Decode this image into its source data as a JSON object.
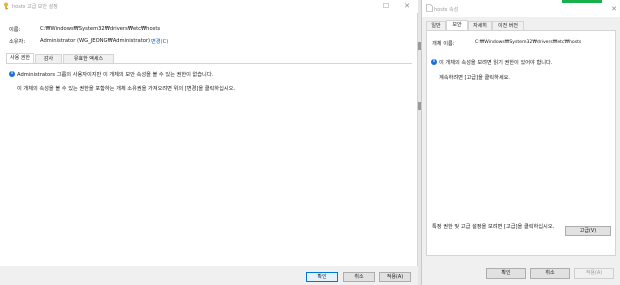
{
  "left_window": {
    "title": "hosts 고급 보안 설정",
    "name_label": "이름:",
    "name_value": "C:₩Windows₩System32₩drivers₩etc₩hosts",
    "owner_label": "소유자:",
    "owner_value": "Administrator (WG_JEONG₩Administrator)",
    "owner_change_link": "변경(C)",
    "tabs": [
      {
        "label": "사용 권한",
        "active": true
      },
      {
        "label": "감사",
        "active": false
      },
      {
        "label": "유효한 액세스",
        "active": false
      }
    ],
    "info_message": "Administrators 그룹의 사용자이지만 이 개체의 보안 속성을 볼 수 있는 권한이 없습니다.",
    "secondary_message": "이 개체의 속성을 볼 수 있는 권한을 포함하는 개체 소유권을 가져오려면 위의 [변경]을 클릭하십시오.",
    "buttons": {
      "ok": "확인",
      "cancel": "취소",
      "apply": "적용(A)"
    }
  },
  "right_window": {
    "title": "hosts 속성",
    "tabs": [
      {
        "label": "일반",
        "active": false
      },
      {
        "label": "보안",
        "active": true
      },
      {
        "label": "자세히",
        "active": false
      },
      {
        "label": "이전 버전",
        "active": false
      }
    ],
    "object_name_label": "개체 이름:",
    "object_name_value": "C:₩Windows₩System32₩drivers₩etc₩hosts",
    "info_message": "이 개체의 속성을 보려면 읽기 권한이 있어야 합니다.",
    "continue_message": "계속하려면 [고급]을 클릭하세요.",
    "advanced_text": "특정 권한 및 고급 설정을 보려면 [고급]을 클릭하십시오.",
    "advanced_button": "고급(V)",
    "buttons": {
      "ok": "확인",
      "cancel": "취소",
      "apply": "적용(A)"
    }
  },
  "colors": {
    "accent_blue": "#0078d7",
    "link_blue": "#0066cc",
    "info_icon_blue": "#1e6fd9",
    "green_strip": "#17b04a"
  }
}
